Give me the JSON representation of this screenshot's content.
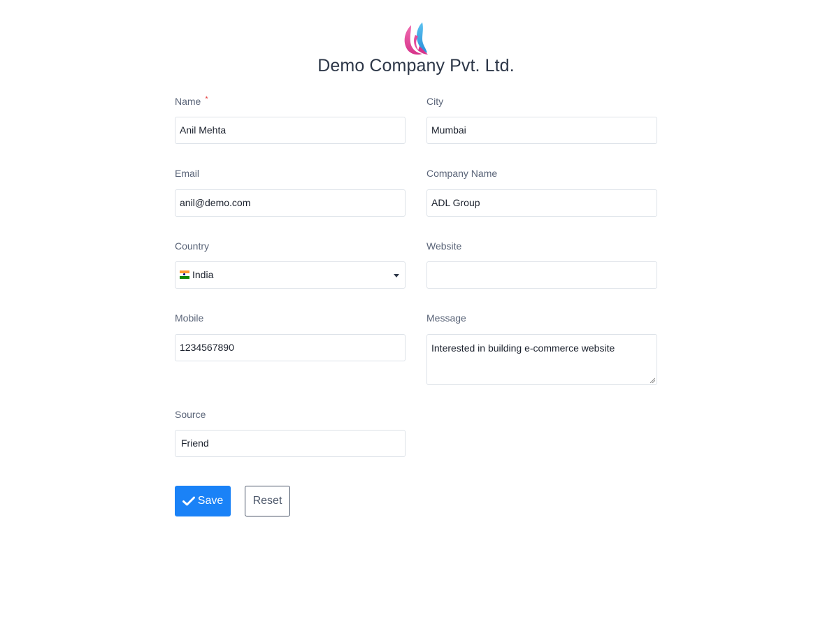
{
  "header": {
    "logo_icon": "flame-swirl-logo-icon",
    "company_name": "Demo Company Pvt. Ltd."
  },
  "form": {
    "name": {
      "label": "Name",
      "required_mark": "*",
      "value": "Anil Mehta"
    },
    "city": {
      "label": "City",
      "value": "Mumbai"
    },
    "email": {
      "label": "Email",
      "value": "anil@demo.com"
    },
    "company_name": {
      "label": "Company Name",
      "value": "ADL Group"
    },
    "country": {
      "label": "Country",
      "value": "India",
      "flag_icon": "india-flag-icon"
    },
    "website": {
      "label": "Website",
      "value": ""
    },
    "mobile": {
      "label": "Mobile",
      "value": "1234567890"
    },
    "message": {
      "label": "Message",
      "value": "Interested in building e-commerce website"
    },
    "source": {
      "label": "Source",
      "value": "Friend"
    }
  },
  "actions": {
    "save_label": "Save",
    "save_icon": "check-icon",
    "reset_label": "Reset"
  },
  "colors": {
    "primary": "#1a82f7",
    "required": "#e53e3e",
    "label": "#5a6478",
    "border": "#dde2e8"
  }
}
